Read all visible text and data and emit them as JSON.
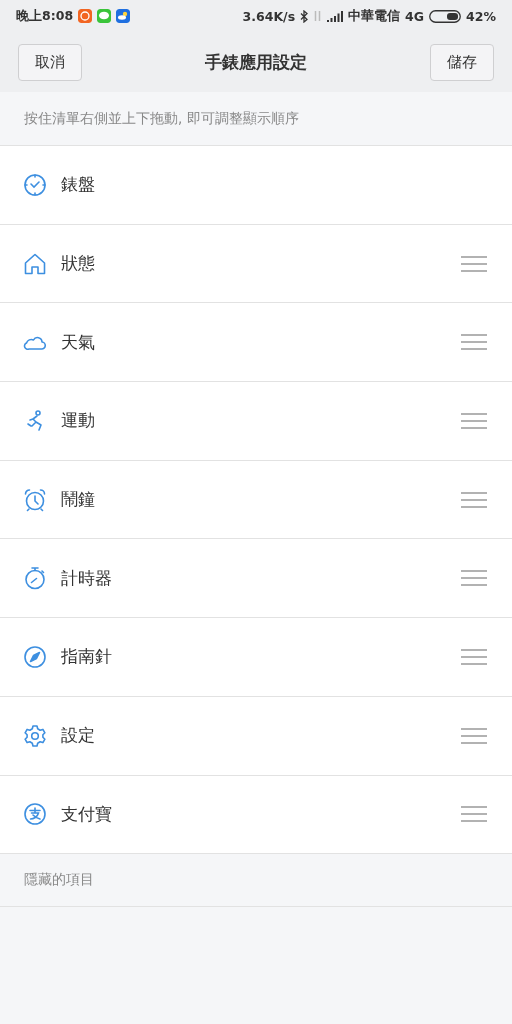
{
  "status_bar": {
    "time": "晚上8:08",
    "speed": "3.64K/s",
    "carrier": "中華電信",
    "network": "4G",
    "battery": "42%"
  },
  "header": {
    "cancel": "取消",
    "title": "手錶應用設定",
    "save": "儲存"
  },
  "hint": "按住清單右側並上下拖動, 即可調整顯示順序",
  "items": [
    {
      "label": "錶盤",
      "draggable": false
    },
    {
      "label": "狀態",
      "draggable": true
    },
    {
      "label": "天氣",
      "draggable": true
    },
    {
      "label": "運動",
      "draggable": true
    },
    {
      "label": "鬧鐘",
      "draggable": true
    },
    {
      "label": "計時器",
      "draggable": true
    },
    {
      "label": "指南針",
      "draggable": true
    },
    {
      "label": "設定",
      "draggable": true
    },
    {
      "label": "支付寶",
      "draggable": true
    }
  ],
  "hidden_section": {
    "title": "隱藏的項目"
  }
}
